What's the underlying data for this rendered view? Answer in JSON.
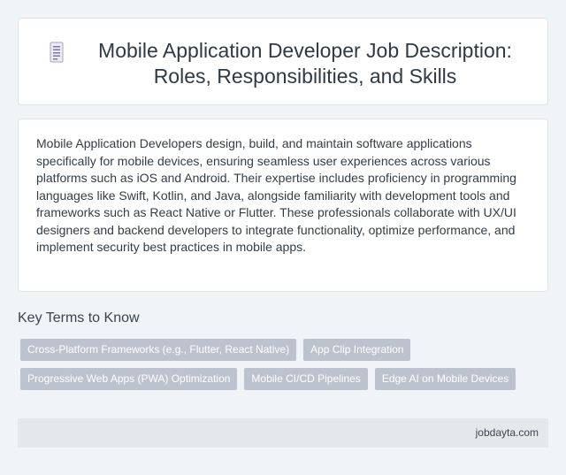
{
  "header": {
    "icon": "document-icon",
    "title": "Mobile Application Developer Job Description: Roles, Responsibilities, and Skills"
  },
  "description": "Mobile Application Developers design, build, and maintain software applications specifically for mobile devices, ensuring seamless user experiences across various platforms such as iOS and Android. Their expertise includes proficiency in programming languages like Swift, Kotlin, and Java, alongside familiarity with development tools and frameworks such as React Native or Flutter. These professionals collaborate with UX/UI designers and backend developers to integrate functionality, optimize performance, and implement security best practices in mobile apps.",
  "key_terms": {
    "heading": "Key Terms to Know",
    "tags": [
      "Cross-Platform Frameworks (e.g., Flutter, React Native)",
      "App Clip Integration",
      "Progressive Web Apps (PWA) Optimization",
      "Mobile CI/CD Pipelines",
      "Edge AI on Mobile Devices"
    ]
  },
  "footer": {
    "site": "jobdayta.com"
  },
  "colors": {
    "background": "#f1f4f6",
    "tag_background": "#bcc3ce",
    "footer_background": "#e3e9ea"
  }
}
